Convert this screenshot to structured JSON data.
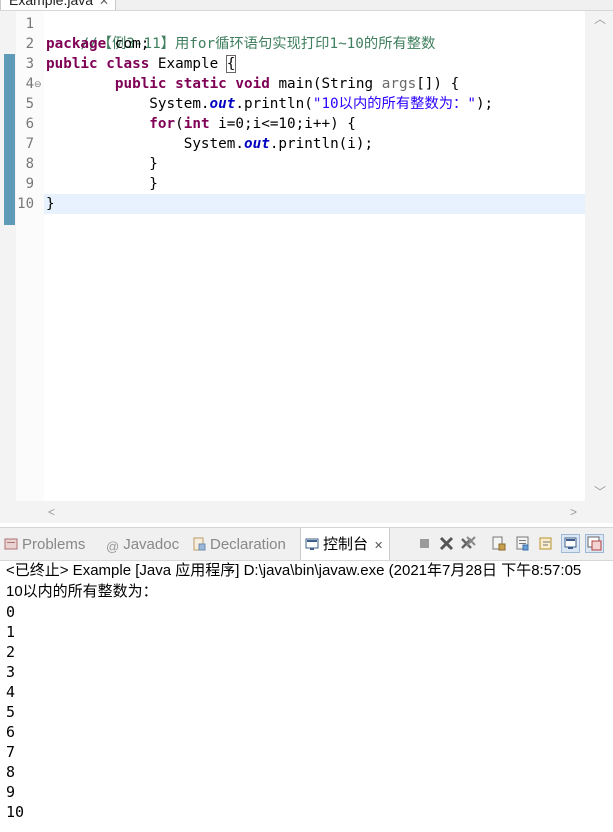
{
  "editor": {
    "tab_title": "Example.java",
    "tab_close": "✕",
    "line_numbers": [
      "1",
      "2",
      "3",
      "4",
      "5",
      "6",
      "7",
      "8",
      "9",
      "10"
    ],
    "lines": {
      "l1_comment": "//【例3-11】用for循环语句实现打印1~10的所有整数",
      "l2_kw": "package",
      "l2_rest": " com;",
      "l3_kw1": "public",
      "l3_kw2": "class",
      "l3_name": " Example ",
      "l3_brace": "{",
      "l4_indent": "        ",
      "l4_kw1": "public",
      "l4_kw2": "static",
      "l4_kw3": "void",
      "l4_rest1": " main(String ",
      "l4_args": "args",
      "l4_rest2": "[]) {",
      "l5_indent": "            System.",
      "l5_out": "out",
      "l5_mid": ".println(",
      "l5_str": "\"10以内的所有整数为：\"",
      "l5_end": ");",
      "l6_indent": "            ",
      "l6_kw1": "for",
      "l6_mid1": "(",
      "l6_kw2": "int",
      "l6_rest": " i=0;i<=10;i++) {",
      "l7_indent": "                System.",
      "l7_out": "out",
      "l7_rest": ".println(i);",
      "l8": "            }",
      "l9": "            }",
      "l10": "}"
    },
    "fold_marker": "⊖"
  },
  "views": {
    "tabs": [
      {
        "label": "Problems"
      },
      {
        "label": "Javadoc"
      },
      {
        "label": "Declaration"
      },
      {
        "label": "控制台"
      }
    ],
    "close": "✕"
  },
  "console": {
    "status": "<已终止> Example [Java 应用程序] D:\\java\\bin\\javaw.exe  (2021年7月28日 下午8:57:05",
    "output": [
      "10以内的所有整数为：",
      "0",
      "1",
      "2",
      "3",
      "4",
      "5",
      "6",
      "7",
      "8",
      "9",
      "10"
    ]
  }
}
